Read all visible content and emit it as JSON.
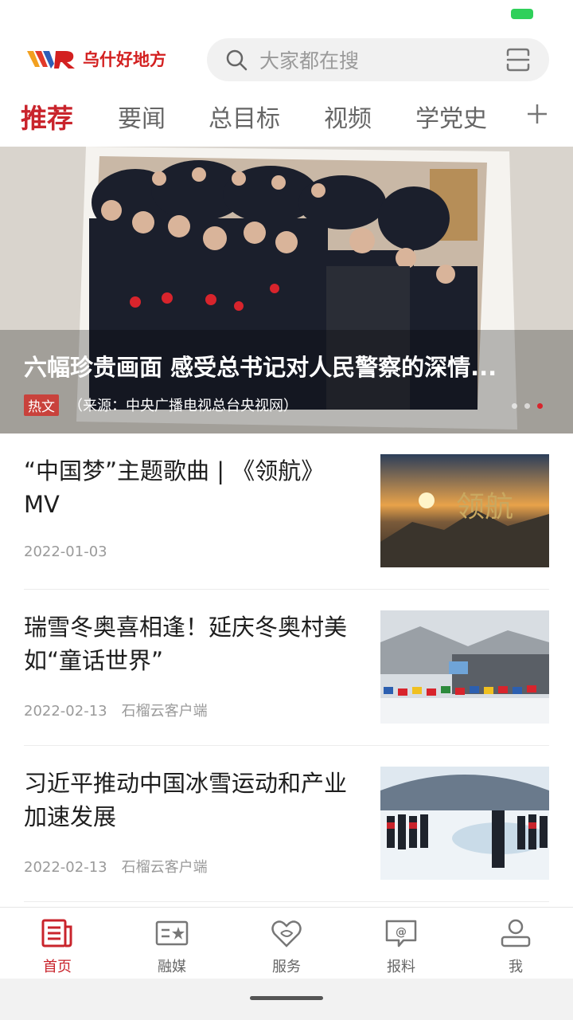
{
  "app": {
    "logo_text": "乌什好地方",
    "search_placeholder": "大家都在搜"
  },
  "tabs": [
    {
      "label": "推荐",
      "active": true
    },
    {
      "label": "要闻"
    },
    {
      "label": "总目标"
    },
    {
      "label": "视频"
    },
    {
      "label": "学党史"
    }
  ],
  "banner": {
    "title": "六幅珍贵画面 感受总书记对人民警察的深情...",
    "tag": "热文",
    "source": "（来源：中央广播电视总台央视网）",
    "slide_count": 3,
    "active_slide": 3
  },
  "news": [
    {
      "title": "“中国梦”主题歌曲 | 《领航》MV",
      "date": "2022-01-03",
      "source": ""
    },
    {
      "title": "瑞雪冬奥喜相逢！延庆冬奥村美如“童话世界”",
      "date": "2022-02-13",
      "source": "石榴云客户端"
    },
    {
      "title": "习近平推动中国冰雪运动和产业加速发展",
      "date": "2022-02-13",
      "source": "石榴云客户端"
    }
  ],
  "bottom_nav": [
    {
      "label": "首页",
      "icon": "news-icon",
      "active": true
    },
    {
      "label": "融媒",
      "icon": "media-icon"
    },
    {
      "label": "服务",
      "icon": "heart-service-icon"
    },
    {
      "label": "报料",
      "icon": "report-chat-icon"
    },
    {
      "label": "我",
      "icon": "user-icon"
    }
  ],
  "colors": {
    "accent": "#c9242c",
    "battery": "#2fd05a"
  }
}
